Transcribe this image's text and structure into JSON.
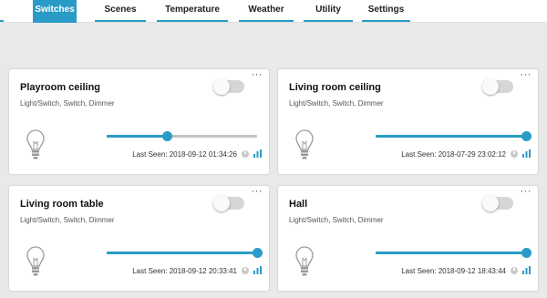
{
  "nav": {
    "active_index": 0,
    "tabs": [
      {
        "label": "Switches"
      },
      {
        "label": "Scenes"
      },
      {
        "label": "Temperature"
      },
      {
        "label": "Weather"
      },
      {
        "label": "Utility"
      },
      {
        "label": "Settings"
      }
    ]
  },
  "card_menu_glyph": "···",
  "colors": {
    "accent": "#2a9bc6",
    "toggle_off": "#d6d6d6",
    "track": "#c4c4c4"
  },
  "devices": [
    {
      "title": "Playroom ceiling",
      "subtitle": "Light/Switch, Switch, Dimmer",
      "switch_on": false,
      "dim_level_percent": 40,
      "last_seen": "Last Seen: 2018-09-12 01:34:26",
      "icon": "lightbulb-icon"
    },
    {
      "title": "Living room ceiling",
      "subtitle": "Light/Switch, Switch, Dimmer",
      "switch_on": false,
      "dim_level_percent": 100,
      "last_seen": "Last Seen: 2018-07-29 23:02:12",
      "icon": "lightbulb-icon"
    },
    {
      "title": "Living room table",
      "subtitle": "Light/Switch, Switch, Dimmer",
      "switch_on": false,
      "dim_level_percent": 100,
      "last_seen": "Last Seen: 2018-09-12 20:33:41",
      "icon": "lightbulb-icon"
    },
    {
      "title": "Hall",
      "subtitle": "Light/Switch, Switch, Dimmer",
      "switch_on": false,
      "dim_level_percent": 100,
      "last_seen": "Last Seen: 2018-09-12 18:43:44",
      "icon": "lightbulb-icon"
    }
  ]
}
